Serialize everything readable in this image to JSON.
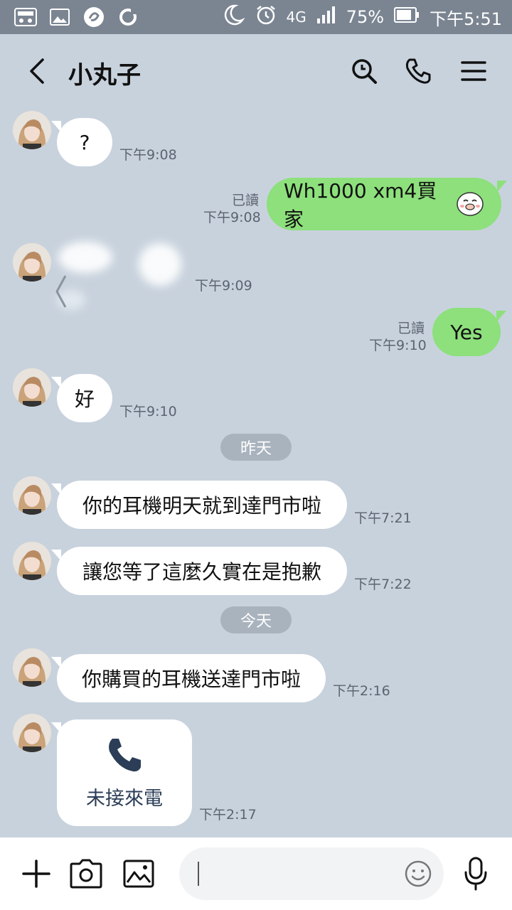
{
  "status_bar": {
    "network": "4G",
    "battery": "75%",
    "time": "下午5:51"
  },
  "header": {
    "contact_name": "小丸子",
    "icons": [
      "back-icon",
      "search-icon",
      "phone-icon",
      "menu-icon"
    ]
  },
  "messages": [
    {
      "side": "in",
      "text": "?",
      "time": "下午9:08"
    },
    {
      "side": "out",
      "text": "Wh1000 xm4買家",
      "read": "已讀",
      "time": "下午9:08"
    },
    {
      "side": "in",
      "type": "blurred-image",
      "time": "下午9:09"
    },
    {
      "side": "out",
      "text": "Yes",
      "read": "已讀",
      "time": "下午9:10"
    },
    {
      "side": "in",
      "text": "好",
      "time": "下午9:10"
    },
    {
      "side": "in",
      "text": "你的耳機明天就到達門市啦",
      "time": "下午7:21"
    },
    {
      "side": "in",
      "text": "讓您等了這麼久實在是抱歉",
      "time": "下午7:22"
    },
    {
      "side": "in",
      "text": "你購買的耳機送達門市啦",
      "time": "下午2:16"
    },
    {
      "side": "in",
      "type": "missed-call",
      "text": "未接來電",
      "time": "下午2:17"
    }
  ],
  "date_separators": {
    "yesterday": "昨天",
    "today": "今天"
  },
  "input_bar": {
    "icons": [
      "plus-icon",
      "camera-icon",
      "image-icon",
      "emoji-icon",
      "microphone-icon"
    ]
  },
  "colors": {
    "background": "#c8d2dd",
    "outgoing_bubble": "#8de07c",
    "incoming_bubble": "#ffffff",
    "status_bar": "#7b8592"
  }
}
